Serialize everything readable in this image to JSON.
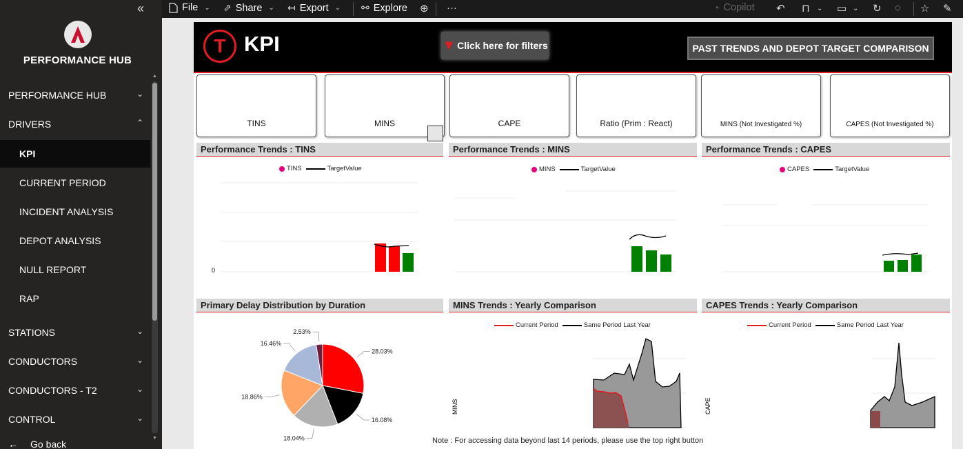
{
  "sidebar": {
    "title": "PERFORMANCE HUB",
    "collapse_icon": "«",
    "items": [
      {
        "label": "PERFORMANCE HUB",
        "chev": "⌄"
      },
      {
        "label": "DRIVERS",
        "chev": "⌃"
      },
      {
        "label": "KPI"
      },
      {
        "label": "CURRENT PERIOD"
      },
      {
        "label": "INCIDENT ANALYSIS"
      },
      {
        "label": "DEPOT ANALYSIS"
      },
      {
        "label": "NULL REPORT"
      },
      {
        "label": "RAP"
      },
      {
        "label": "STATIONS",
        "chev": "⌄"
      },
      {
        "label": "CONDUCTORS",
        "chev": "⌄"
      },
      {
        "label": "CONDUCTORS - T2",
        "chev": "⌄"
      },
      {
        "label": "CONTROL",
        "chev": "⌄"
      }
    ],
    "go_back": "Go back",
    "go_back_icon": "←"
  },
  "toolbar": {
    "file": "File",
    "share": "Share",
    "export": "Export",
    "explore": "Explore",
    "more": "···",
    "copilot": "Copilot"
  },
  "header": {
    "logo_letter": "T",
    "title": "KPI",
    "filter_button": "Click here for filters",
    "past_trends_button": "PAST TRENDS AND DEPOT TARGET COMPARISON"
  },
  "cards": [
    "TINS",
    "MINS",
    "CAPE",
    "Ratio (Prim : React)",
    "MINS (Not Investigated %)",
    "CAPES (Not Investigated %)"
  ],
  "panels": {
    "tins": {
      "title": "Performance Trends : TINS",
      "legend_a": "TINS",
      "legend_b": "TargetValue",
      "zero_label": "0"
    },
    "mins": {
      "title": "Performance Trends : MINS",
      "legend_a": "MINS",
      "legend_b": "TargetValue"
    },
    "capes": {
      "title": "Performance Trends : CAPES",
      "legend_a": "CAPES",
      "legend_b": "TargetValue"
    },
    "pie": {
      "title": "Primary Delay Distribution by Duration"
    },
    "mins_yearly": {
      "title": "MINS Trends : Yearly Comparison",
      "legend_a": "Current Period",
      "legend_b": "Same Period Last Year",
      "ylabel": "MINS"
    },
    "capes_yearly": {
      "title": "CAPES Trends : Yearly Comparison",
      "legend_a": "Current Period",
      "legend_b": "Same Period Last Year",
      "ylabel": "CAPE"
    }
  },
  "chart_data": [
    {
      "type": "pie",
      "slices": [
        {
          "value": 28.03,
          "label": "28.03%",
          "color": "#ff0000"
        },
        {
          "value": 16.08,
          "label": "16.08%",
          "color": "#000000"
        },
        {
          "value": 18.04,
          "label": "18.04%",
          "color": "#b0b0b0"
        },
        {
          "value": 18.86,
          "label": "18.86%",
          "color": "#ffa566"
        },
        {
          "value": 16.46,
          "label": "16.46%",
          "color": "#a8b8d8"
        },
        {
          "value": 2.53,
          "label": "2.53%",
          "color": "#6e1f3e"
        }
      ]
    }
  ],
  "note": "Note : For accessing data beyond last 14 periods, please use the top right button",
  "colors": {
    "accent": "#e31b23",
    "green": "#008000",
    "pink": "#e3007a"
  }
}
